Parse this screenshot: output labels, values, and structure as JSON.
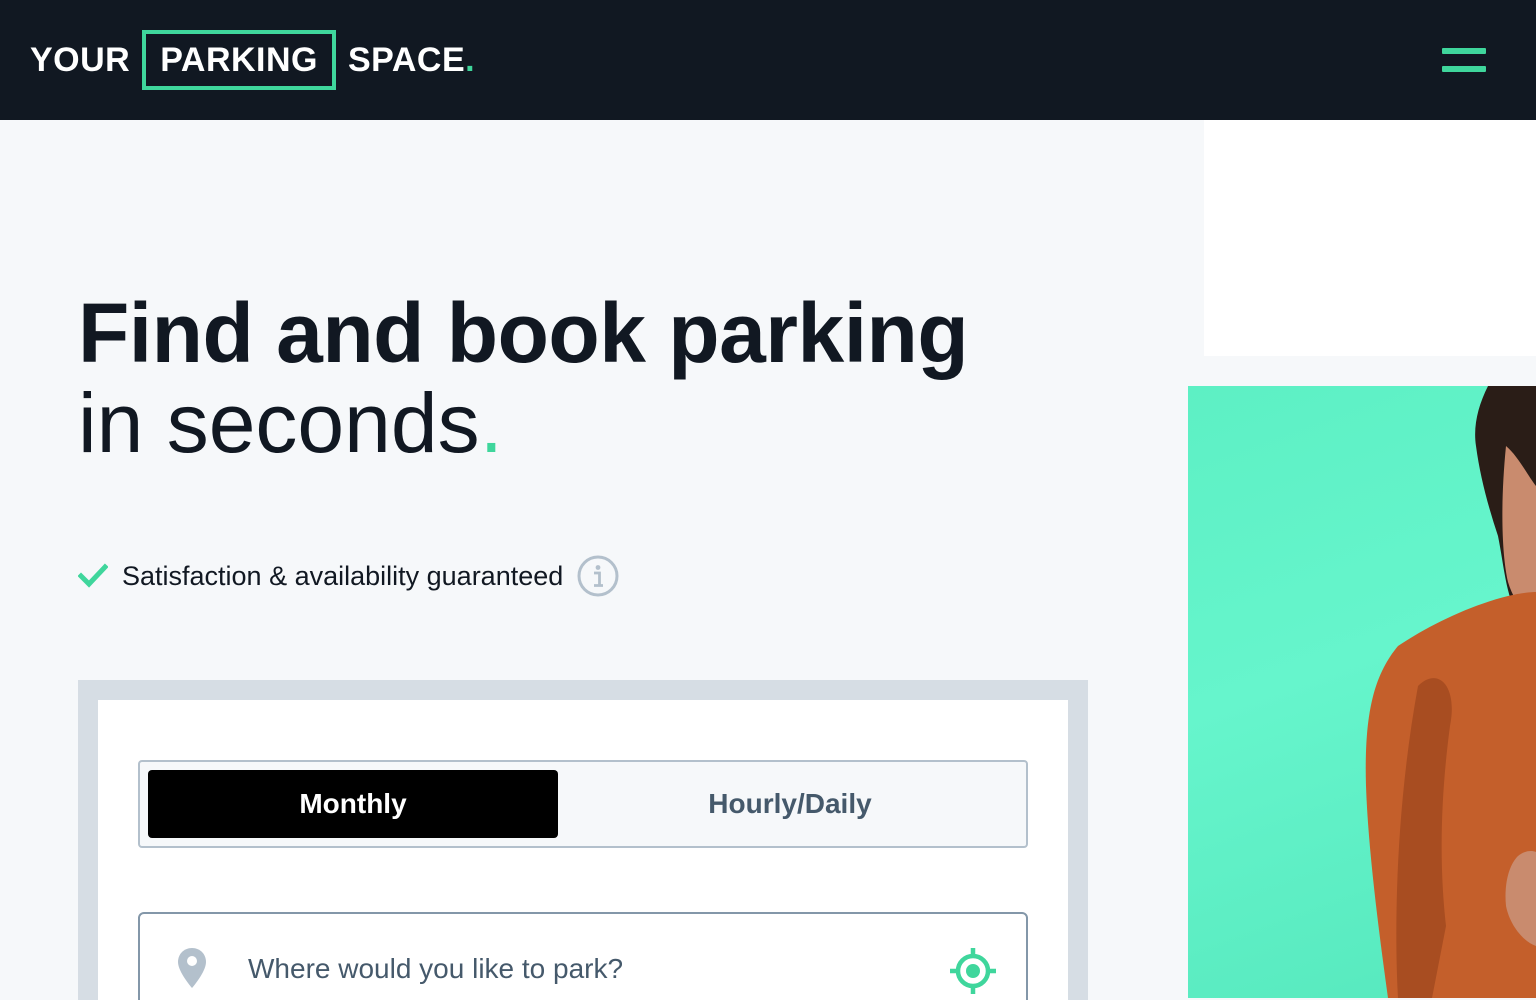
{
  "header": {
    "logo": {
      "part1": "YOUR",
      "part2": "PARKING",
      "part3": "SPACE",
      "dot": "."
    },
    "menu_icon": "hamburger-menu-icon"
  },
  "hero": {
    "headline_line1": "Find and book parking",
    "headline_line2": "in seconds",
    "headline_dot": ".",
    "guarantee_text": "Satisfaction & availability guaranteed",
    "check_icon": "check-icon",
    "info_icon": "info-icon"
  },
  "search": {
    "tabs": [
      {
        "label": "Monthly",
        "active": true
      },
      {
        "label": "Hourly/Daily",
        "active": false
      }
    ],
    "placeholder": "Where would you like to park?",
    "pin_icon": "location-pin-icon",
    "locate_icon": "locate-me-icon"
  },
  "colors": {
    "brand_green": "#3fd69c",
    "header_bg": "#111822",
    "active_tab_bg": "#000000",
    "photo_bg": "#5df0c4"
  }
}
